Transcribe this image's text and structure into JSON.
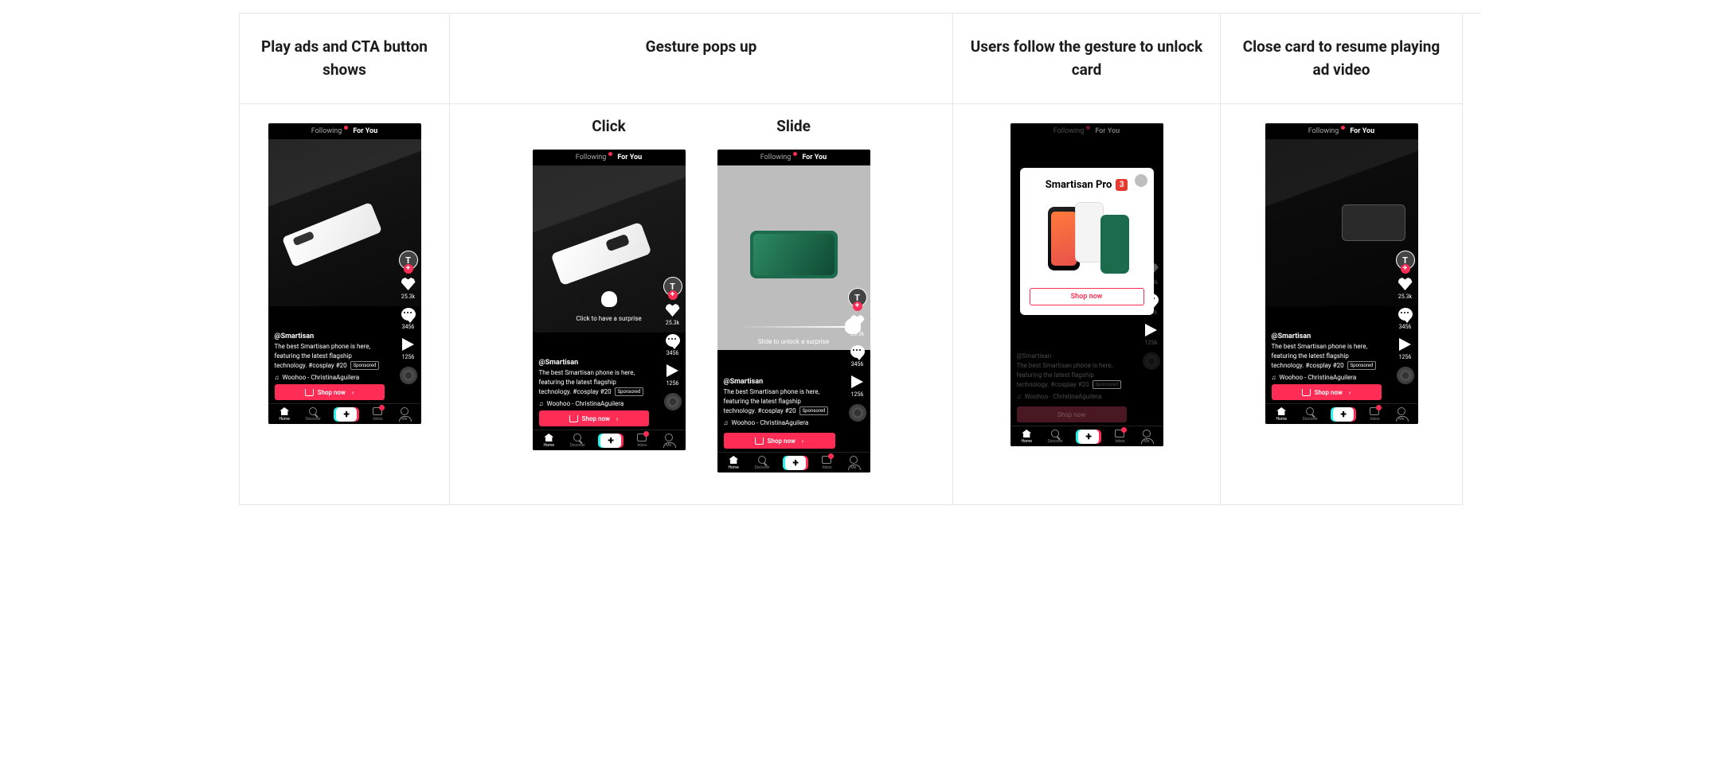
{
  "headers": {
    "step1": "Play ads and CTA button shows",
    "step2": "Gesture pops up",
    "step3": "Users follow the gesture to unlock card",
    "step4": "Close card to resume playing ad video"
  },
  "gestures": {
    "click_title": "Click",
    "slide_title": "Slide",
    "click_hint": "Click to have a surprise",
    "slide_hint": "Slide to unlock a surprise"
  },
  "feed_tabs": {
    "following": "Following",
    "for_you": "For You"
  },
  "rail": {
    "avatar_letter": "T",
    "likes": "25.3k",
    "comments": "3456",
    "shares": "1256"
  },
  "caption": {
    "user": "@Smartisan",
    "text": "The best Smartisan phone is here, featuring the latest flagship technology. #cosplay #20",
    "sponsored": "Sponsored",
    "music": "Woohoo - ChristinaAguilera"
  },
  "cta": {
    "label": "Shop now"
  },
  "nav": {
    "home": "Home",
    "discover": "Discover",
    "inbox": "Inbox",
    "me": "Me"
  },
  "unlock_card": {
    "title": "Smartisan Pro",
    "badge": "3",
    "cta": "Shop now"
  }
}
